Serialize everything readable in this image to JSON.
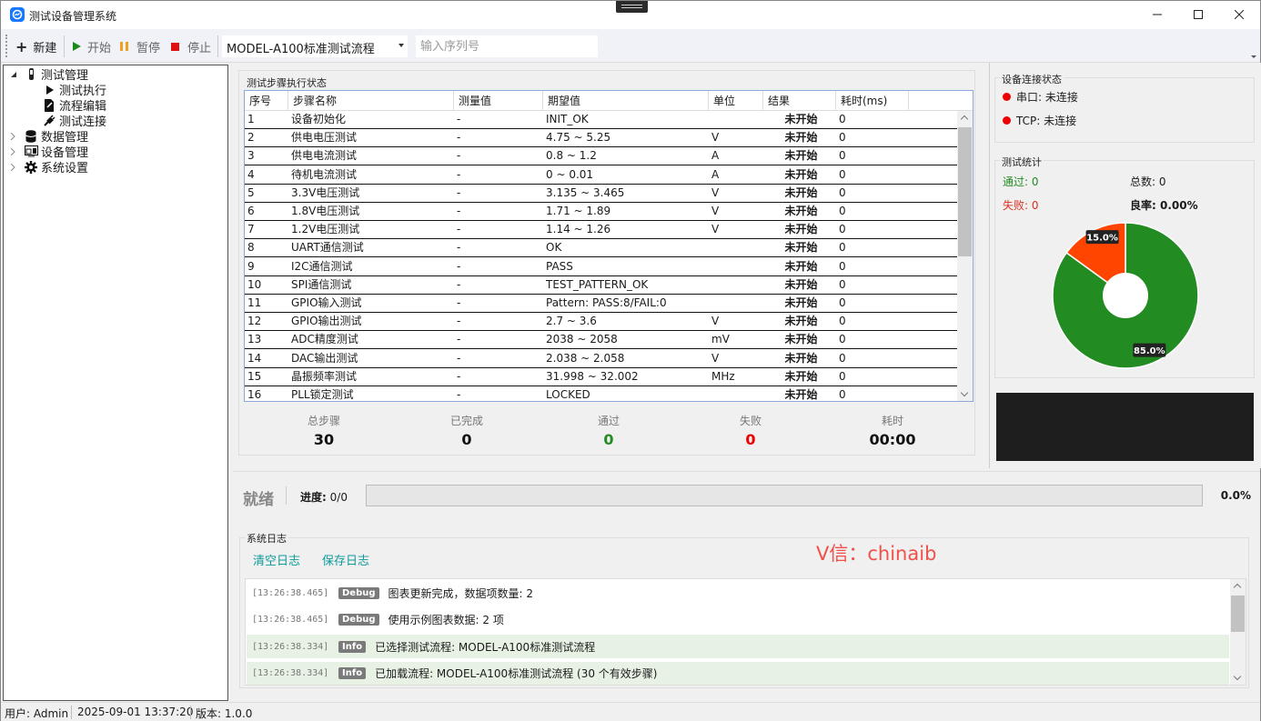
{
  "window": {
    "title": "测试设备管理系统"
  },
  "toolbar": {
    "new_label": "新建",
    "start_label": "开始",
    "pause_label": "暂停",
    "stop_label": "停止",
    "flow_selected": "MODEL-A100标准测试流程",
    "serial_placeholder": "输入序列号"
  },
  "tree": {
    "items": [
      {
        "label": "测试管理",
        "icon": "test-tube-icon",
        "expanded": true
      },
      {
        "label": "测试执行",
        "icon": "play-icon"
      },
      {
        "label": "流程编辑",
        "icon": "document-edit-icon"
      },
      {
        "label": "测试连接",
        "icon": "plug-icon"
      },
      {
        "label": "数据管理",
        "icon": "database-icon"
      },
      {
        "label": "设备管理",
        "icon": "device-icon"
      },
      {
        "label": "系统设置",
        "icon": "gear-icon"
      }
    ]
  },
  "steps": {
    "group_title": "测试步骤执行状态",
    "columns": [
      "序号",
      "步骤名称",
      "测量值",
      "期望值",
      "单位",
      "结果",
      "耗时(ms)"
    ],
    "rows": [
      [
        "1",
        "设备初始化",
        "-",
        "INIT_OK",
        "",
        "未开始",
        "0"
      ],
      [
        "2",
        "供电电压测试",
        "-",
        "4.75 ~ 5.25",
        "V",
        "未开始",
        "0"
      ],
      [
        "3",
        "供电电流测试",
        "-",
        "0.8 ~ 1.2",
        "A",
        "未开始",
        "0"
      ],
      [
        "4",
        "待机电流测试",
        "-",
        "0 ~ 0.01",
        "A",
        "未开始",
        "0"
      ],
      [
        "5",
        "3.3V电压测试",
        "-",
        "3.135 ~ 3.465",
        "V",
        "未开始",
        "0"
      ],
      [
        "6",
        "1.8V电压测试",
        "-",
        "1.71 ~ 1.89",
        "V",
        "未开始",
        "0"
      ],
      [
        "7",
        "1.2V电压测试",
        "-",
        "1.14 ~ 1.26",
        "V",
        "未开始",
        "0"
      ],
      [
        "8",
        "UART通信测试",
        "-",
        "OK",
        "",
        "未开始",
        "0"
      ],
      [
        "9",
        "I2C通信测试",
        "-",
        "PASS",
        "",
        "未开始",
        "0"
      ],
      [
        "10",
        "SPI通信测试",
        "-",
        "TEST_PATTERN_OK",
        "",
        "未开始",
        "0"
      ],
      [
        "11",
        "GPIO输入测试",
        "-",
        "Pattern: PASS:8/FAIL:0",
        "",
        "未开始",
        "0"
      ],
      [
        "12",
        "GPIO输出测试",
        "-",
        "2.7 ~ 3.6",
        "V",
        "未开始",
        "0"
      ],
      [
        "13",
        "ADC精度测试",
        "-",
        "2038 ~ 2058",
        "mV",
        "未开始",
        "0"
      ],
      [
        "14",
        "DAC输出测试",
        "-",
        "2.038 ~ 2.058",
        "V",
        "未开始",
        "0"
      ],
      [
        "15",
        "晶振频率测试",
        "-",
        "31.998 ~ 32.002",
        "MHz",
        "未开始",
        "0"
      ],
      [
        "16",
        "PLL锁定测试",
        "-",
        "LOCKED",
        "",
        "未开始",
        "0"
      ]
    ]
  },
  "summary": {
    "total_label": "总步骤",
    "total_value": "30",
    "done_label": "已完成",
    "done_value": "0",
    "pass_label": "通过",
    "pass_value": "0",
    "fail_label": "失败",
    "fail_value": "0",
    "time_label": "耗时",
    "time_value": "00:00"
  },
  "connection": {
    "group_title": "设备连接状态",
    "serial": "串口: 未连接",
    "tcp": "TCP: 未连接"
  },
  "stats": {
    "group_title": "测试统计",
    "pass": "通过: 0",
    "total": "总数: 0",
    "fail": "失败: 0",
    "yield": "良率: 0.00%"
  },
  "chart_data": {
    "type": "pie",
    "donut": true,
    "slices": [
      {
        "label": "85.0%",
        "value": 85.0,
        "color": "#228b22"
      },
      {
        "label": "15.0%",
        "value": 15.0,
        "color": "#ff4500"
      }
    ]
  },
  "status": {
    "state": "就绪",
    "progress_label": "进度:",
    "progress_text": "0/0",
    "progress": 0,
    "percent": "0.0%"
  },
  "log": {
    "group_title": "系统日志",
    "clear_label": "清空日志",
    "save_label": "保存日志",
    "watermark": "V信：chinaib",
    "entries": [
      {
        "time": "[13:26:38.465]",
        "level": "Debug",
        "message": "图表更新完成，数据项数量: 2"
      },
      {
        "time": "[13:26:38.465]",
        "level": "Debug",
        "message": "使用示例图表数据: 2 项"
      },
      {
        "time": "[13:26:38.334]",
        "level": "Info",
        "message": "已选择测试流程: MODEL-A100标准测试流程"
      },
      {
        "time": "[13:26:38.334]",
        "level": "Info",
        "message": "已加载流程: MODEL-A100标准测试流程 (30 个有效步骤)"
      }
    ]
  },
  "statusbar": {
    "user": "用户: Admin",
    "datetime": "2025-09-01 13:37:20",
    "version": "版本: 1.0.0"
  },
  "colors": {
    "pass": "#228b22",
    "fail": "#ff4500",
    "accent": "#1677ff",
    "link": "#0e9a9a"
  }
}
